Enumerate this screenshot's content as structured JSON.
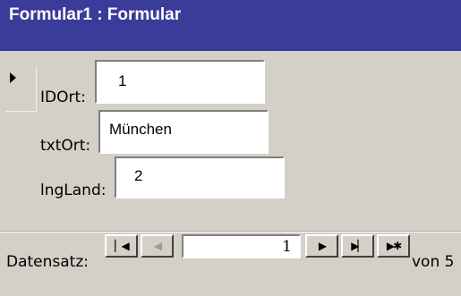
{
  "window": {
    "title": "Formular1 : Formular"
  },
  "form": {
    "fields": [
      {
        "label": "IDOrt:",
        "value": "1"
      },
      {
        "label": "txtOrt:",
        "value": "München"
      },
      {
        "label": "lngLand:",
        "value": "2"
      }
    ]
  },
  "navigation": {
    "label": "Datensatz:",
    "current_record": "1",
    "total_label": "von 5",
    "buttons": {
      "first": "▏◀",
      "prev": "◀",
      "next": "▶",
      "last": "▶▏",
      "new": "▶✱"
    }
  },
  "colors": {
    "titlebar": "#3b3b99",
    "background": "#d4d0c8",
    "field_bg": "#ffffff"
  }
}
